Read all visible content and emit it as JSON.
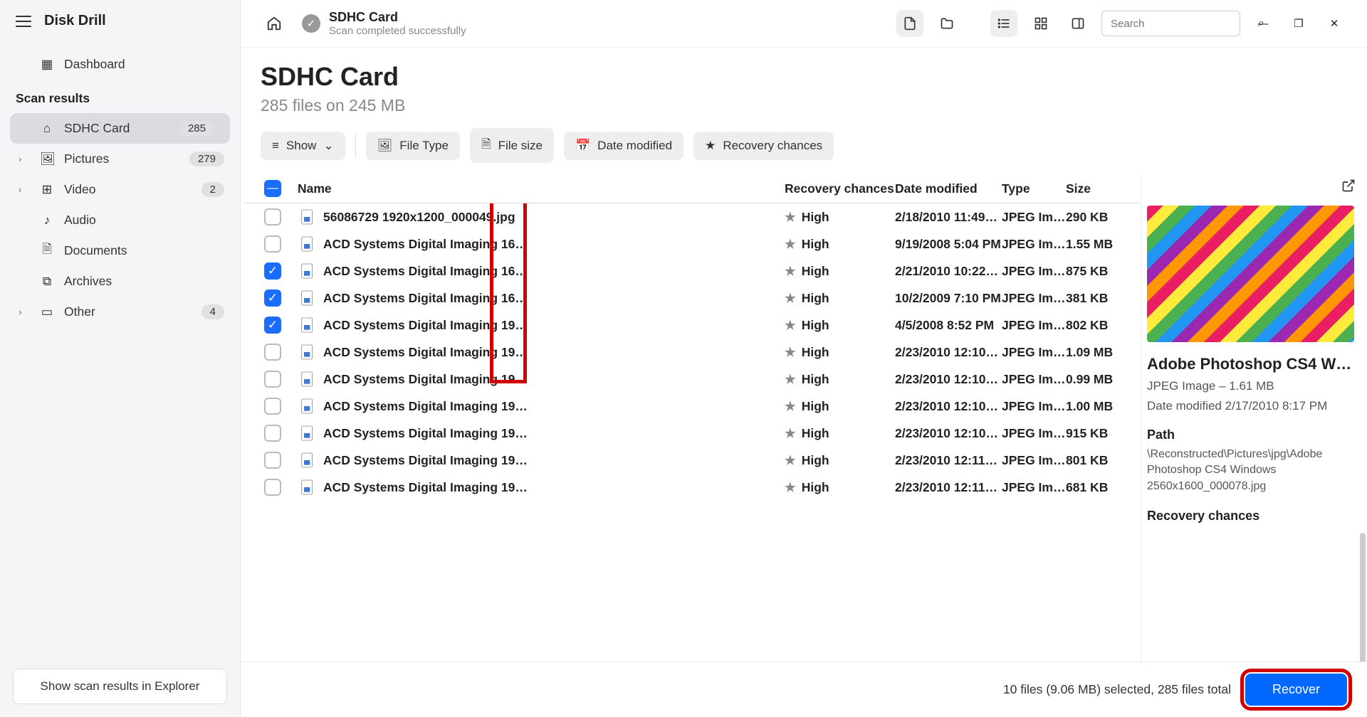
{
  "app": {
    "title": "Disk Drill"
  },
  "sidebar": {
    "dashboard": "Dashboard",
    "section": "Scan results",
    "items": [
      {
        "icon": "drive",
        "label": "SDHC Card",
        "count": "285",
        "selected": true,
        "expandable": false
      },
      {
        "icon": "picture",
        "label": "Pictures",
        "count": "279",
        "selected": false,
        "expandable": true
      },
      {
        "icon": "video",
        "label": "Video",
        "count": "2",
        "selected": false,
        "expandable": true
      },
      {
        "icon": "audio",
        "label": "Audio",
        "count": "",
        "selected": false,
        "expandable": false
      },
      {
        "icon": "document",
        "label": "Documents",
        "count": "",
        "selected": false,
        "expandable": false
      },
      {
        "icon": "archive",
        "label": "Archives",
        "count": "",
        "selected": false,
        "expandable": false
      },
      {
        "icon": "other",
        "label": "Other",
        "count": "4",
        "selected": false,
        "expandable": true
      }
    ],
    "explorer_btn": "Show scan results in Explorer"
  },
  "topbar": {
    "status_title": "SDHC Card",
    "status_sub": "Scan completed successfully",
    "search_placeholder": "Search"
  },
  "header": {
    "title": "SDHC Card",
    "sub": "285 files on 245 MB"
  },
  "filters": {
    "show": "Show",
    "file_type": "File Type",
    "file_size": "File size",
    "date_modified": "Date modified",
    "recovery_chances": "Recovery chances"
  },
  "columns": {
    "name": "Name",
    "recovery": "Recovery chances",
    "date": "Date modified",
    "type": "Type",
    "size": "Size"
  },
  "rows": [
    {
      "checked": false,
      "name": "56086729 1920x1200_000049.jpg",
      "recovery": "High",
      "date": "2/18/2010 11:49…",
      "type": "JPEG Im…",
      "size": "290 KB"
    },
    {
      "checked": false,
      "name": "ACD Systems Digital Imaging 16…",
      "recovery": "High",
      "date": "9/19/2008 5:04 PM",
      "type": "JPEG Im…",
      "size": "1.55 MB"
    },
    {
      "checked": true,
      "name": "ACD Systems Digital Imaging 16…",
      "recovery": "High",
      "date": "2/21/2010 10:22…",
      "type": "JPEG Im…",
      "size": "875 KB"
    },
    {
      "checked": true,
      "name": "ACD Systems Digital Imaging 16…",
      "recovery": "High",
      "date": "10/2/2009 7:10 PM",
      "type": "JPEG Im…",
      "size": "381 KB"
    },
    {
      "checked": true,
      "name": "ACD Systems Digital Imaging 19…",
      "recovery": "High",
      "date": "4/5/2008 8:52 PM",
      "type": "JPEG Im…",
      "size": "802 KB"
    },
    {
      "checked": false,
      "name": "ACD Systems Digital Imaging 19…",
      "recovery": "High",
      "date": "2/23/2010 12:10…",
      "type": "JPEG Im…",
      "size": "1.09 MB"
    },
    {
      "checked": false,
      "name": "ACD Systems Digital Imaging 19…",
      "recovery": "High",
      "date": "2/23/2010 12:10…",
      "type": "JPEG Im…",
      "size": "0.99 MB"
    },
    {
      "checked": false,
      "name": "ACD Systems Digital Imaging 19…",
      "recovery": "High",
      "date": "2/23/2010 12:10…",
      "type": "JPEG Im…",
      "size": "1.00 MB"
    },
    {
      "checked": false,
      "name": "ACD Systems Digital Imaging 19…",
      "recovery": "High",
      "date": "2/23/2010 12:10…",
      "type": "JPEG Im…",
      "size": "915 KB"
    },
    {
      "checked": false,
      "name": "ACD Systems Digital Imaging 19…",
      "recovery": "High",
      "date": "2/23/2010 12:11…",
      "type": "JPEG Im…",
      "size": "801 KB"
    },
    {
      "checked": false,
      "name": "ACD Systems Digital Imaging 19…",
      "recovery": "High",
      "date": "2/23/2010 12:11…",
      "type": "JPEG Im…",
      "size": "681 KB"
    }
  ],
  "preview": {
    "title": "Adobe Photoshop CS4 W…",
    "type_size": "JPEG Image – 1.61 MB",
    "modified": "Date modified 2/17/2010 8:17 PM",
    "path_label": "Path",
    "path": "\\Reconstructed\\Pictures\\jpg\\Adobe Photoshop CS4 Windows 2560x1600_000078.jpg",
    "recovery_label": "Recovery chances"
  },
  "footer": {
    "summary": "10 files (9.06 MB) selected, 285 files total",
    "recover": "Recover"
  }
}
